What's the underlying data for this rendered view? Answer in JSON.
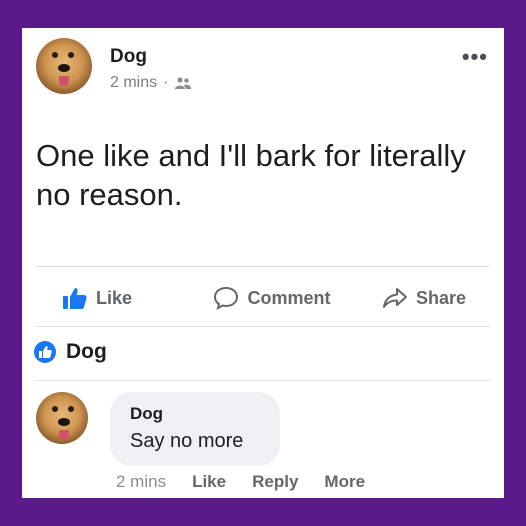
{
  "post": {
    "author": "Dog",
    "time": "2 mins",
    "separator": "·",
    "audience_icon": "friends-icon",
    "more_icon": "•••",
    "text": "One like and I'll bark for literally no reason."
  },
  "actions": {
    "like": "Like",
    "comment": "Comment",
    "share": "Share"
  },
  "commenting_as": {
    "name": "Dog"
  },
  "comment": {
    "author": "Dog",
    "text": "Say no more",
    "time": "2 mins",
    "like": "Like",
    "reply": "Reply",
    "more": "More"
  },
  "colors": {
    "background": "#5b1a8b",
    "accent": "#1877f2"
  }
}
